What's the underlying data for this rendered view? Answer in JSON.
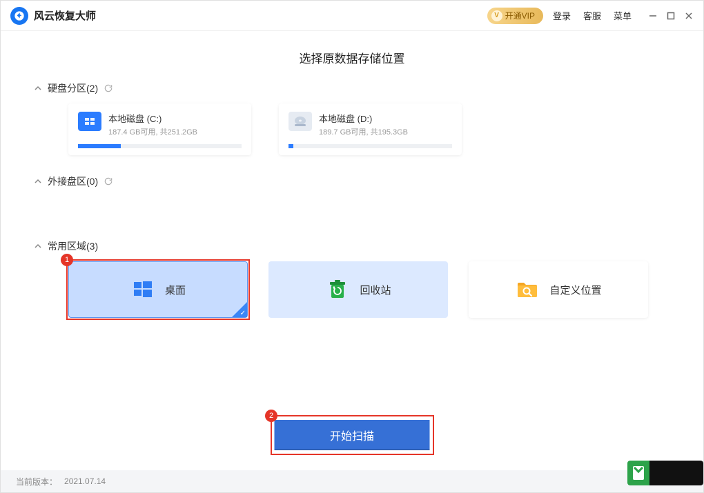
{
  "app": {
    "title": "风云恢复大师"
  },
  "titlebar": {
    "vip_label": "开通VIP",
    "login": "登录",
    "support": "客服",
    "menu": "菜单"
  },
  "page": {
    "heading": "选择原数据存储位置"
  },
  "sections": {
    "disks": {
      "label": "硬盘分区",
      "count": "(2)"
    },
    "external": {
      "label": "外接盘区",
      "count": "(0)"
    },
    "common": {
      "label": "常用区域",
      "count": "(3)"
    }
  },
  "disks": [
    {
      "name": "本地磁盘 (C:)",
      "sub": "187.4 GB可用, 共251.2GB",
      "used_pct": 26,
      "icon_color": "#2b7cff"
    },
    {
      "name": "本地磁盘 (D:)",
      "sub": "189.7 GB可用, 共195.3GB",
      "used_pct": 3,
      "icon_color": "#b8c4d4"
    }
  ],
  "areas": [
    {
      "label": "桌面",
      "key": "desktop"
    },
    {
      "label": "回收站",
      "key": "recycle"
    },
    {
      "label": "自定义位置",
      "key": "custom"
    }
  ],
  "scan_button": "开始扫描",
  "footer": {
    "version_label": "当前版本：",
    "version": "2021.07.14"
  },
  "callouts": {
    "one": "1",
    "two": "2"
  }
}
